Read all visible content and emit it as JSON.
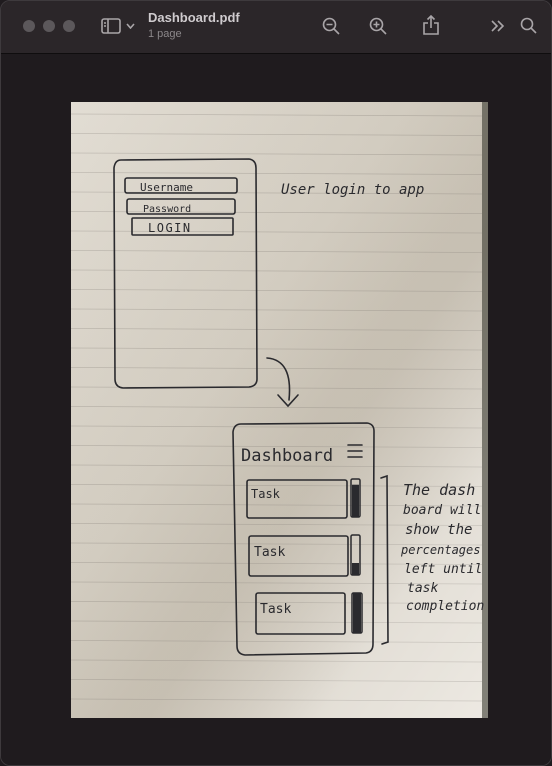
{
  "window": {
    "title": "Dashboard.pdf",
    "subtitle": "1 page"
  },
  "toolbar": {
    "sidebar_icon": "sidebar-icon",
    "chevron_icon": "chevron-down-icon",
    "zoom_out_icon": "zoom-out-icon",
    "zoom_in_icon": "zoom-in-icon",
    "share_icon": "share-icon",
    "more_icon": "double-chevron-icon",
    "search_icon": "search-icon"
  },
  "sketch": {
    "login": {
      "username": "Username",
      "password": "Password",
      "button": "LOGIN",
      "note": "User login to app"
    },
    "dashboard": {
      "title": "Dashboard",
      "tasks": [
        {
          "label": "Task",
          "progress": 0.85
        },
        {
          "label": "Task",
          "progress": 0.3
        },
        {
          "label": "Task",
          "progress": 1.0
        }
      ],
      "note": [
        "The dash",
        "board will",
        "show the",
        "percentages",
        "left until",
        "task",
        "completion"
      ]
    }
  },
  "colors": {
    "titlebar": "#2b2629",
    "background": "#1f1b1e",
    "ink": "#2a2a2e",
    "paper": "#d8d2c6"
  }
}
